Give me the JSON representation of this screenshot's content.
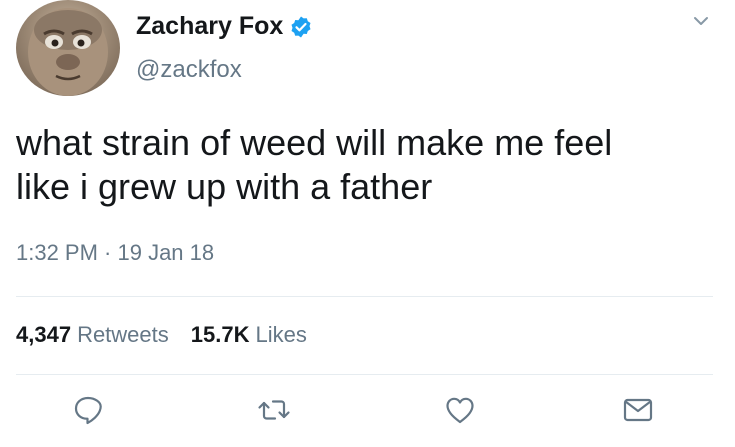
{
  "author": {
    "display_name": "Zachary Fox",
    "handle": "@zackfox",
    "verified": true
  },
  "tweet": {
    "text_lines": [
      "what strain of weed will make me feel",
      "like i grew up with a father"
    ],
    "timestamp": "1:32 PM · 19 Jan 18"
  },
  "stats": {
    "retweets_count": "4,347",
    "retweets_label": "Retweets",
    "likes_count": "15.7K",
    "likes_label": "Likes"
  },
  "icons": {
    "verified": "verified-badge-icon",
    "caret": "chevron-down-icon",
    "reply": "reply-icon",
    "retweet": "retweet-icon",
    "like": "heart-icon",
    "dm": "envelope-icon"
  },
  "colors": {
    "verified_blue": "#1da1f2",
    "secondary_text": "#657786",
    "primary_text": "#14171a",
    "divider": "#e6ecf0"
  }
}
